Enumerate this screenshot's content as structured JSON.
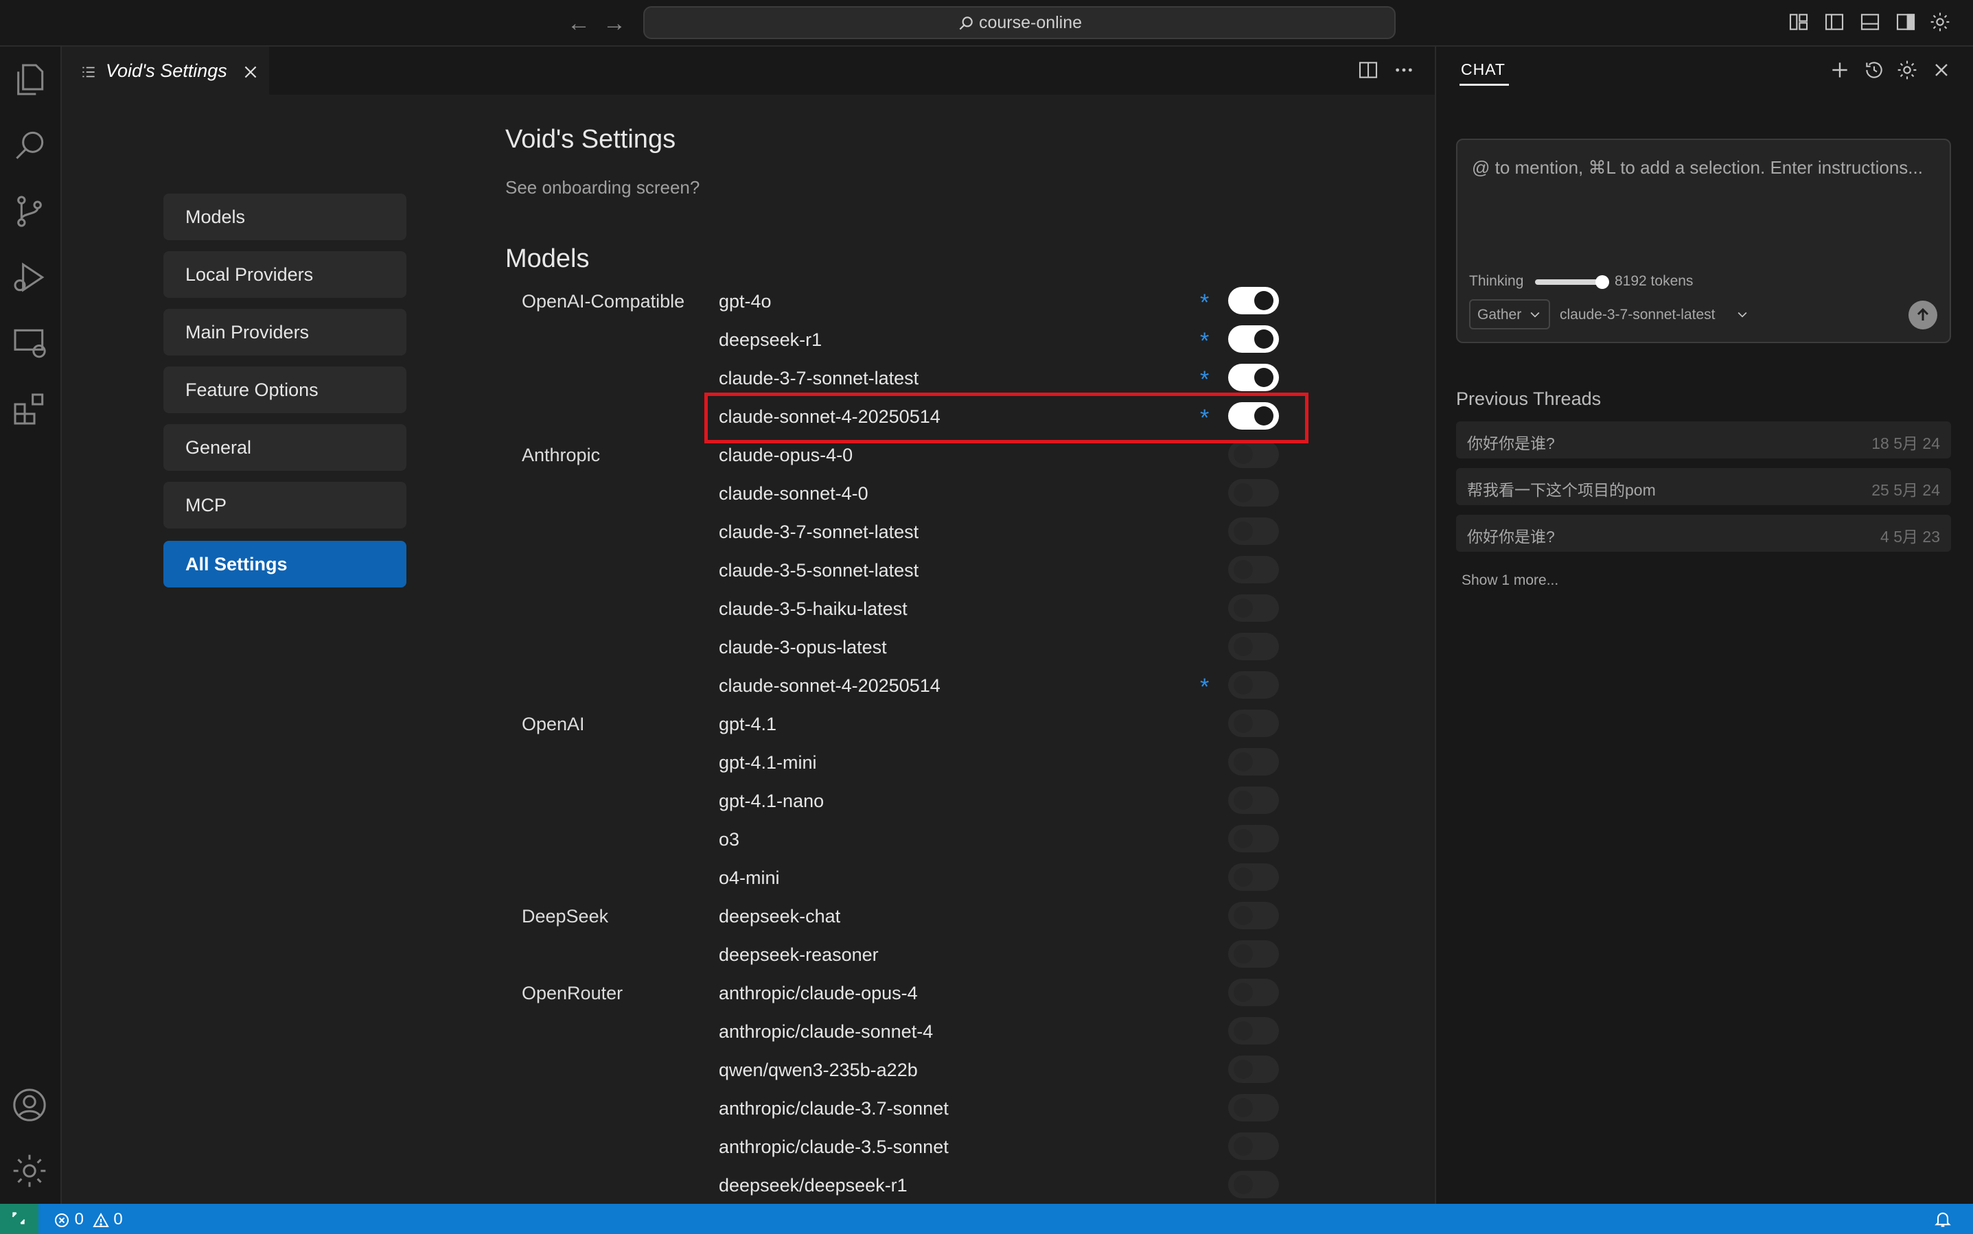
{
  "titlebar": {
    "search_text": "course-online"
  },
  "tab": {
    "title": "Void's Settings"
  },
  "sidebar_nav": {
    "items": [
      "Models",
      "Local Providers",
      "Main Providers",
      "Feature Options",
      "General",
      "MCP",
      "All Settings"
    ],
    "active": "All Settings"
  },
  "settings": {
    "title": "Void's Settings",
    "onboarding_link": "See onboarding screen?",
    "models_heading": "Models",
    "providers": [
      "OpenAI-Compatible",
      "Anthropic",
      "OpenAI",
      "DeepSeek",
      "OpenRouter"
    ],
    "models": [
      {
        "name": "gpt-4o",
        "provider": "OpenAI-Compatible",
        "custom": true,
        "enabled": true
      },
      {
        "name": "deepseek-r1",
        "provider": "OpenAI-Compatible",
        "custom": true,
        "enabled": true
      },
      {
        "name": "claude-3-7-sonnet-latest",
        "provider": "OpenAI-Compatible",
        "custom": true,
        "enabled": true
      },
      {
        "name": "claude-sonnet-4-20250514",
        "provider": "OpenAI-Compatible",
        "custom": true,
        "enabled": true,
        "highlighted": true
      },
      {
        "name": "claude-opus-4-0",
        "provider": "Anthropic",
        "custom": false,
        "enabled": false
      },
      {
        "name": "claude-sonnet-4-0",
        "provider": "Anthropic",
        "custom": false,
        "enabled": false
      },
      {
        "name": "claude-3-7-sonnet-latest",
        "provider": "Anthropic",
        "custom": false,
        "enabled": false
      },
      {
        "name": "claude-3-5-sonnet-latest",
        "provider": "Anthropic",
        "custom": false,
        "enabled": false
      },
      {
        "name": "claude-3-5-haiku-latest",
        "provider": "Anthropic",
        "custom": false,
        "enabled": false
      },
      {
        "name": "claude-3-opus-latest",
        "provider": "Anthropic",
        "custom": false,
        "enabled": false
      },
      {
        "name": "claude-sonnet-4-20250514",
        "provider": "Anthropic",
        "custom": true,
        "enabled": false
      },
      {
        "name": "gpt-4.1",
        "provider": "OpenAI",
        "custom": false,
        "enabled": false
      },
      {
        "name": "gpt-4.1-mini",
        "provider": "OpenAI",
        "custom": false,
        "enabled": false
      },
      {
        "name": "gpt-4.1-nano",
        "provider": "OpenAI",
        "custom": false,
        "enabled": false
      },
      {
        "name": "o3",
        "provider": "OpenAI",
        "custom": false,
        "enabled": false
      },
      {
        "name": "o4-mini",
        "provider": "OpenAI",
        "custom": false,
        "enabled": false
      },
      {
        "name": "deepseek-chat",
        "provider": "DeepSeek",
        "custom": false,
        "enabled": false
      },
      {
        "name": "deepseek-reasoner",
        "provider": "DeepSeek",
        "custom": false,
        "enabled": false
      },
      {
        "name": "anthropic/claude-opus-4",
        "provider": "OpenRouter",
        "custom": false,
        "enabled": false
      },
      {
        "name": "anthropic/claude-sonnet-4",
        "provider": "OpenRouter",
        "custom": false,
        "enabled": false
      },
      {
        "name": "qwen/qwen3-235b-a22b",
        "provider": "OpenRouter",
        "custom": false,
        "enabled": false
      },
      {
        "name": "anthropic/claude-3.7-sonnet",
        "provider": "OpenRouter",
        "custom": false,
        "enabled": false
      },
      {
        "name": "anthropic/claude-3.5-sonnet",
        "provider": "OpenRouter",
        "custom": false,
        "enabled": false
      },
      {
        "name": "deepseek/deepseek-r1",
        "provider": "OpenRouter",
        "custom": false,
        "enabled": false
      }
    ],
    "custom_marker": "*"
  },
  "chat": {
    "tab_label": "CHAT",
    "placeholder": "@ to mention, ⌘L to add a selection. Enter instructions...",
    "thinking_label": "Thinking",
    "thinking_tokens": "8192 tokens",
    "thinking_level": 0.85,
    "mode_select": "Gather",
    "model_select": "claude-3-7-sonnet-latest",
    "previous_threads_heading": "Previous Threads",
    "threads": [
      {
        "title": "你好你是谁?",
        "date": "18 5月 24"
      },
      {
        "title": "帮我看一下这个项目的pom",
        "date": "25 5月 24"
      },
      {
        "title": "你好你是谁?",
        "date": "4 5月 23"
      }
    ],
    "show_more": "Show 1 more..."
  },
  "statusbar": {
    "errors": "0",
    "warnings": "0"
  },
  "colors": {
    "accent": "#0e63b3",
    "statusbar": "#0e7ad0",
    "highlight": "#e0161e",
    "custom_marker": "#2f8fe6"
  }
}
